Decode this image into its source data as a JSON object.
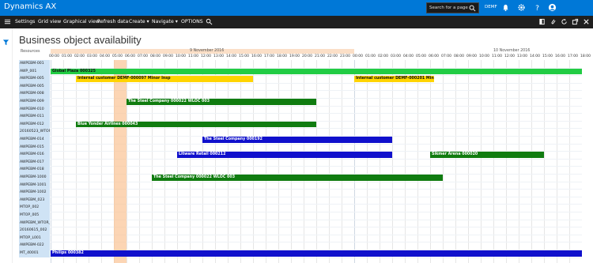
{
  "app": {
    "title": "Dynamics AX"
  },
  "search": {
    "placeholder": "Search for a page"
  },
  "company": "DEMF",
  "actionbar": {
    "items": [
      "Settings",
      "Grid view",
      "Graphical view",
      "Refresh data",
      "Create ▾",
      "Navigate ▾",
      "OPTIONS"
    ]
  },
  "page": {
    "title": "Business object availability"
  },
  "gantt": {
    "resources_label": "Resources",
    "dates": [
      "9 November 2016",
      "10 November 2016"
    ],
    "hours": [
      "00:00",
      "01:00",
      "02:00",
      "03:00",
      "04:00",
      "05:00",
      "06:00",
      "07:00",
      "08:00",
      "09:00",
      "10:00",
      "11:00",
      "12:00",
      "13:00",
      "14:00",
      "15:00",
      "16:00",
      "17:00",
      "18:00",
      "19:00",
      "20:00",
      "21:00",
      "22:00",
      "23:00",
      "00:00",
      "01:00",
      "02:00",
      "03:00",
      "04:00",
      "05:00",
      "06:00",
      "07:00",
      "08:00",
      "09:00",
      "10:00",
      "11:00",
      "12:00",
      "13:00",
      "14:00",
      "15:00",
      "16:00",
      "17:00",
      "18:00"
    ],
    "resources": [
      "AWPEBM-001",
      "AWP_001",
      "AWPEBM-005",
      "AWPEBM-005",
      "AWPEBM-008",
      "AWPEBM-009",
      "AWPEBM-010",
      "AWPEBM-011",
      "AWPEBM-012",
      "20160523_WTOR_01",
      "AWPEBM-014",
      "AWPEBM-015",
      "AWPEBM-016",
      "AWPEBM-017",
      "AWPEBM-018",
      "AWPEBM-1000",
      "AWPEBM-1001",
      "AWPEBM-1002",
      "AWPEBM_023",
      "MTOP_002",
      "MTOP_005",
      "AWPEBM_WTOR_2",
      "20160615_002",
      "MTOP_L001",
      "AWPEBM-022",
      "MT_40001"
    ],
    "bars": [
      {
        "label": "Global Plaza 000325",
        "row": 1,
        "start": 0,
        "end": 42,
        "color": "#22cc44",
        "text": "#111111"
      },
      {
        "label": "Internal customer DEMF-000097 Minor Insp",
        "row": 2,
        "start": 2,
        "end": 16,
        "color": "#ffd400",
        "text": "#111111"
      },
      {
        "label": "Internal customer DEMF-000201 Minor Insp",
        "row": 2,
        "start": 24,
        "end": 30.3,
        "color": "#ffd400",
        "text": "#111111"
      },
      {
        "label": "The Steel Company 000022 WLOC 003",
        "row": 5,
        "start": 6,
        "end": 21,
        "color": "#107c10",
        "text": "#ffffff"
      },
      {
        "label": "Blue Yonder Airlines 000043",
        "row": 8,
        "start": 2,
        "end": 21,
        "color": "#107c10",
        "text": "#ffffff"
      },
      {
        "label": "The Steel Company 000192",
        "row": 10,
        "start": 12,
        "end": 27,
        "color": "#1010cc",
        "text": "#ffffff"
      },
      {
        "label": "Litware Retail 000212",
        "row": 12,
        "start": 10,
        "end": 27,
        "color": "#1010cc",
        "text": "#ffffff"
      },
      {
        "label": "Sikmer Arena 000020",
        "row": 12,
        "start": 30,
        "end": 39,
        "color": "#107c10",
        "text": "#ffffff"
      },
      {
        "label": "The Steel Company 000022 WLOC 003",
        "row": 15,
        "start": 8,
        "end": 31,
        "color": "#107c10",
        "text": "#ffffff"
      },
      {
        "label": "Philips 000382",
        "row": 25,
        "start": 0,
        "end": 42,
        "color": "#1010cc",
        "text": "#ffffff"
      }
    ]
  }
}
